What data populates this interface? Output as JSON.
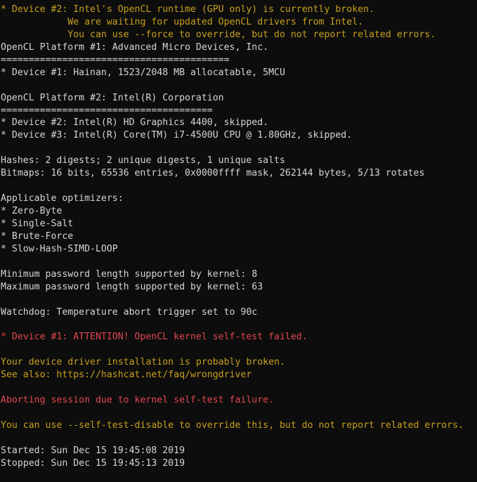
{
  "terminal": {
    "app": "hashcat",
    "background_color": "#0d0d0d",
    "colors": {
      "white": "#d6d6d6",
      "yellow": "#c8a01e",
      "red": "#e2474f"
    },
    "lines": [
      {
        "color": "yellow",
        "text": "* Device #2: Intel's OpenCL runtime (GPU only) is currently broken."
      },
      {
        "color": "yellow",
        "text": "            We are waiting for updated OpenCL drivers from Intel."
      },
      {
        "color": "yellow",
        "text": "            You can use --force to override, but do not report related errors."
      },
      {
        "color": "white",
        "text": "OpenCL Platform #1: Advanced Micro Devices, Inc."
      },
      {
        "color": "white",
        "text": "========================================="
      },
      {
        "color": "white",
        "text": "* Device #1: Hainan, 1523/2048 MB allocatable, 5MCU"
      },
      {
        "color": "white",
        "text": ""
      },
      {
        "color": "white",
        "text": "OpenCL Platform #2: Intel(R) Corporation"
      },
      {
        "color": "white",
        "text": "======================================"
      },
      {
        "color": "white",
        "text": "* Device #2: Intel(R) HD Graphics 4400, skipped."
      },
      {
        "color": "white",
        "text": "* Device #3: Intel(R) Core(TM) i7-4500U CPU @ 1.80GHz, skipped."
      },
      {
        "color": "white",
        "text": ""
      },
      {
        "color": "white",
        "text": "Hashes: 2 digests; 2 unique digests, 1 unique salts"
      },
      {
        "color": "white",
        "text": "Bitmaps: 16 bits, 65536 entries, 0x0000ffff mask, 262144 bytes, 5/13 rotates"
      },
      {
        "color": "white",
        "text": ""
      },
      {
        "color": "white",
        "text": "Applicable optimizers:"
      },
      {
        "color": "white",
        "text": "* Zero-Byte"
      },
      {
        "color": "white",
        "text": "* Single-Salt"
      },
      {
        "color": "white",
        "text": "* Brute-Force"
      },
      {
        "color": "white",
        "text": "* Slow-Hash-SIMD-LOOP"
      },
      {
        "color": "white",
        "text": ""
      },
      {
        "color": "white",
        "text": "Minimum password length supported by kernel: 8"
      },
      {
        "color": "white",
        "text": "Maximum password length supported by kernel: 63"
      },
      {
        "color": "white",
        "text": ""
      },
      {
        "color": "white",
        "text": "Watchdog: Temperature abort trigger set to 90c"
      },
      {
        "color": "white",
        "text": ""
      },
      {
        "color": "red",
        "text": "* Device #1: ATTENTION! OpenCL kernel self-test failed."
      },
      {
        "color": "white",
        "text": ""
      },
      {
        "color": "yellow",
        "text": "Your device driver installation is probably broken."
      },
      {
        "color": "yellow",
        "text": "See also: https://hashcat.net/faq/wrongdriver"
      },
      {
        "color": "white",
        "text": ""
      },
      {
        "color": "red",
        "text": "Aborting session due to kernel self-test failure."
      },
      {
        "color": "white",
        "text": ""
      },
      {
        "color": "yellow",
        "text": "You can use --self-test-disable to override this, but do not report related errors."
      },
      {
        "color": "white",
        "text": ""
      },
      {
        "color": "white",
        "text": "Started: Sun Dec 15 19:45:08 2019"
      },
      {
        "color": "white",
        "text": "Stopped: Sun Dec 15 19:45:13 2019"
      }
    ]
  }
}
